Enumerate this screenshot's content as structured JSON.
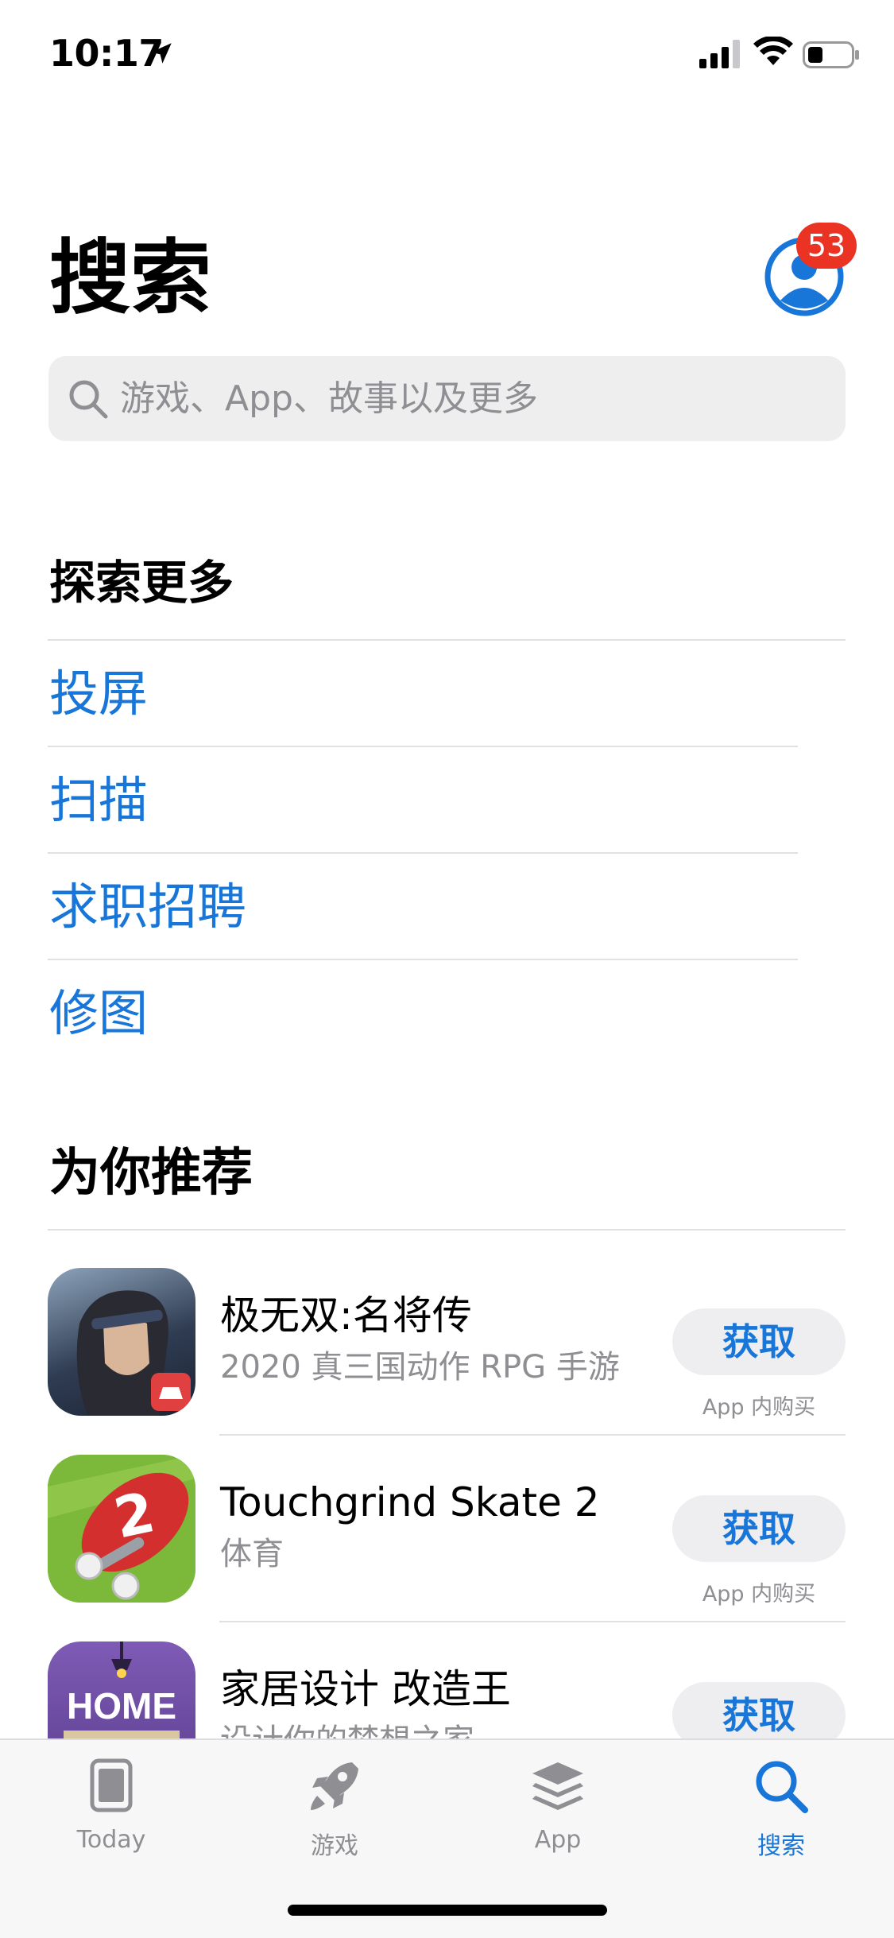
{
  "status_bar": {
    "time": "10:17"
  },
  "header": {
    "title": "搜索",
    "notification_count": "53"
  },
  "search": {
    "placeholder": "游戏、App、故事以及更多"
  },
  "explore": {
    "heading": "探索更多",
    "items": [
      "投屏",
      "扫描",
      "求职招聘",
      "修图"
    ]
  },
  "recommended": {
    "heading": "为你推荐",
    "apps": [
      {
        "name": "极无双:名将传",
        "subtitle": "2020 真三国动作 RPG 手游",
        "button": "获取",
        "iap": "App 内购买"
      },
      {
        "name": "Touchgrind Skate 2",
        "subtitle": "体育",
        "button": "获取",
        "iap": "App 内购买"
      },
      {
        "name": "家居设计 改造王",
        "subtitle": "设计你的梦想之家",
        "button": "获取",
        "icon_text": "HOME"
      }
    ]
  },
  "tab_bar": {
    "tabs": [
      {
        "label": "Today",
        "icon": "today-icon"
      },
      {
        "label": "游戏",
        "icon": "rocket-icon"
      },
      {
        "label": "App",
        "icon": "apps-stack-icon"
      },
      {
        "label": "搜索",
        "icon": "search-icon",
        "active": true
      }
    ]
  },
  "colors": {
    "accent": "#1976d9",
    "badge": "#ea3323",
    "secondary_text": "#8e8e93"
  }
}
